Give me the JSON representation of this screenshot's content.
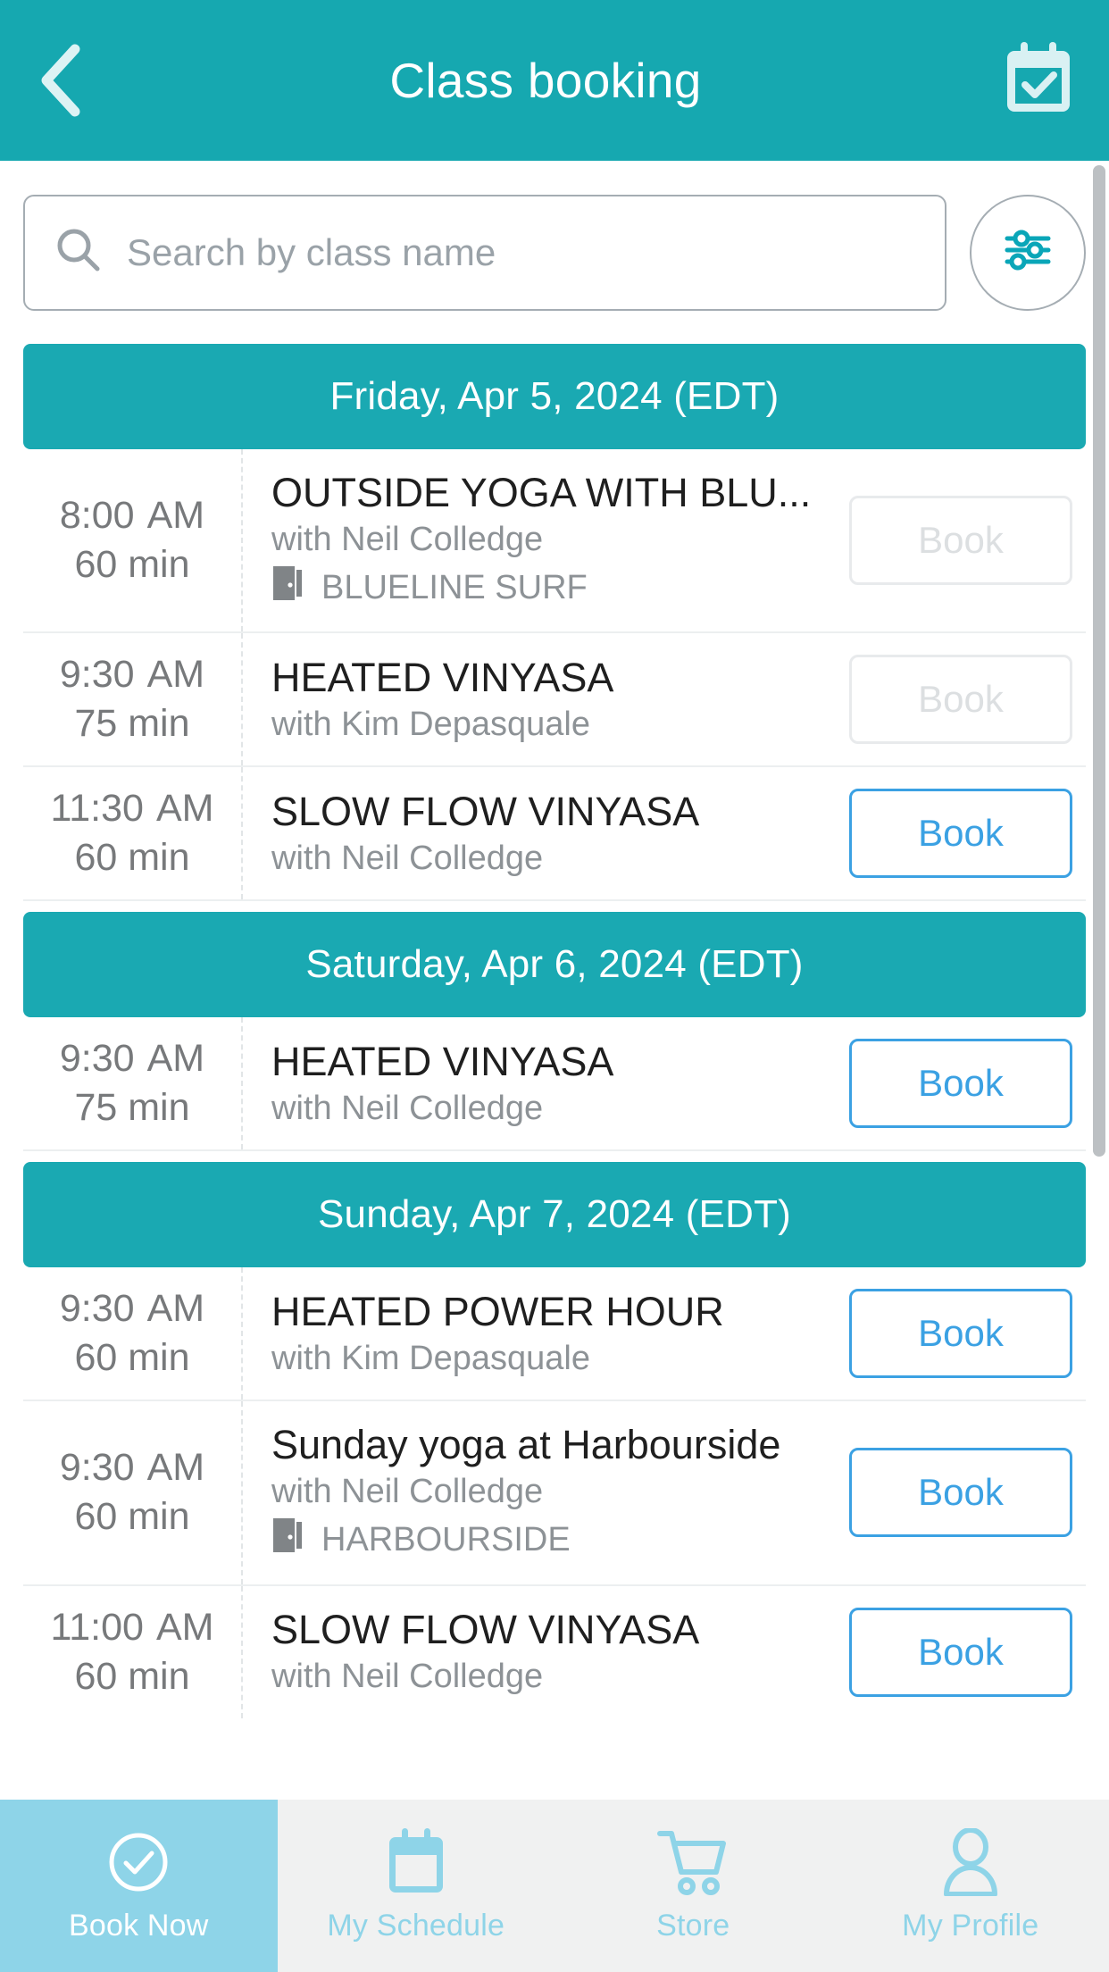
{
  "header": {
    "title": "Class booking",
    "back_icon": "chevron-left-icon",
    "calendar_icon": "calendar-check-icon"
  },
  "search": {
    "placeholder": "Search by class name",
    "value": "",
    "search_icon": "search-icon",
    "filter_icon": "sliders-filter-icon"
  },
  "colors": {
    "teal_header": "#16a8b0",
    "teal_date_band": "#1aa9b2",
    "book_blue": "#3ba1e3",
    "book_disabled": "#dcdfe1",
    "nav_active_bg": "#8ed4e8",
    "nav_inactive_text": "#8ed4e8"
  },
  "schedule": [
    {
      "date": "Friday, Apr 5, 2024 (EDT)",
      "classes": [
        {
          "time": "8:00",
          "ampm": "AM",
          "duration": "60 min",
          "title": "OUTSIDE YOGA WITH BLU...",
          "instructor": "with Neil Colledge",
          "location": "BLUELINE SURF",
          "location_icon": "door-icon",
          "book_label": "Book",
          "book_enabled": false
        },
        {
          "time": "9:30",
          "ampm": "AM",
          "duration": "75 min",
          "title": "HEATED VINYASA",
          "instructor": "with Kim Depasquale",
          "location": "",
          "location_icon": "",
          "book_label": "Book",
          "book_enabled": false
        },
        {
          "time": "11:30",
          "ampm": "AM",
          "duration": "60 min",
          "title": "SLOW FLOW VINYASA",
          "instructor": "with Neil Colledge",
          "location": "",
          "location_icon": "",
          "book_label": "Book",
          "book_enabled": true
        }
      ]
    },
    {
      "date": "Saturday, Apr 6, 2024 (EDT)",
      "classes": [
        {
          "time": "9:30",
          "ampm": "AM",
          "duration": "75 min",
          "title": "HEATED VINYASA",
          "instructor": "with Neil Colledge",
          "location": "",
          "location_icon": "",
          "book_label": "Book",
          "book_enabled": true
        }
      ]
    },
    {
      "date": "Sunday, Apr 7, 2024 (EDT)",
      "classes": [
        {
          "time": "9:30",
          "ampm": "AM",
          "duration": "60 min",
          "title": "HEATED POWER HOUR",
          "instructor": "with Kim Depasquale",
          "location": "",
          "location_icon": "",
          "book_label": "Book",
          "book_enabled": true
        },
        {
          "time": "9:30",
          "ampm": "AM",
          "duration": "60 min",
          "title": "Sunday yoga at Harbourside",
          "instructor": "with Neil Colledge",
          "location": "HARBOURSIDE",
          "location_icon": "door-icon",
          "book_label": "Book",
          "book_enabled": true
        },
        {
          "time": "11:00",
          "ampm": "AM",
          "duration": "60 min",
          "title": "SLOW FLOW VINYASA",
          "instructor": "with Neil Colledge",
          "location": "",
          "location_icon": "",
          "book_label": "Book",
          "book_enabled": true
        }
      ]
    }
  ],
  "bottom_nav": [
    {
      "label": "Book Now",
      "icon": "check-circle-icon",
      "active": true
    },
    {
      "label": "My Schedule",
      "icon": "calendar-icon",
      "active": false
    },
    {
      "label": "Store",
      "icon": "shopping-cart-icon",
      "active": false
    },
    {
      "label": "My Profile",
      "icon": "user-icon",
      "active": false
    }
  ]
}
